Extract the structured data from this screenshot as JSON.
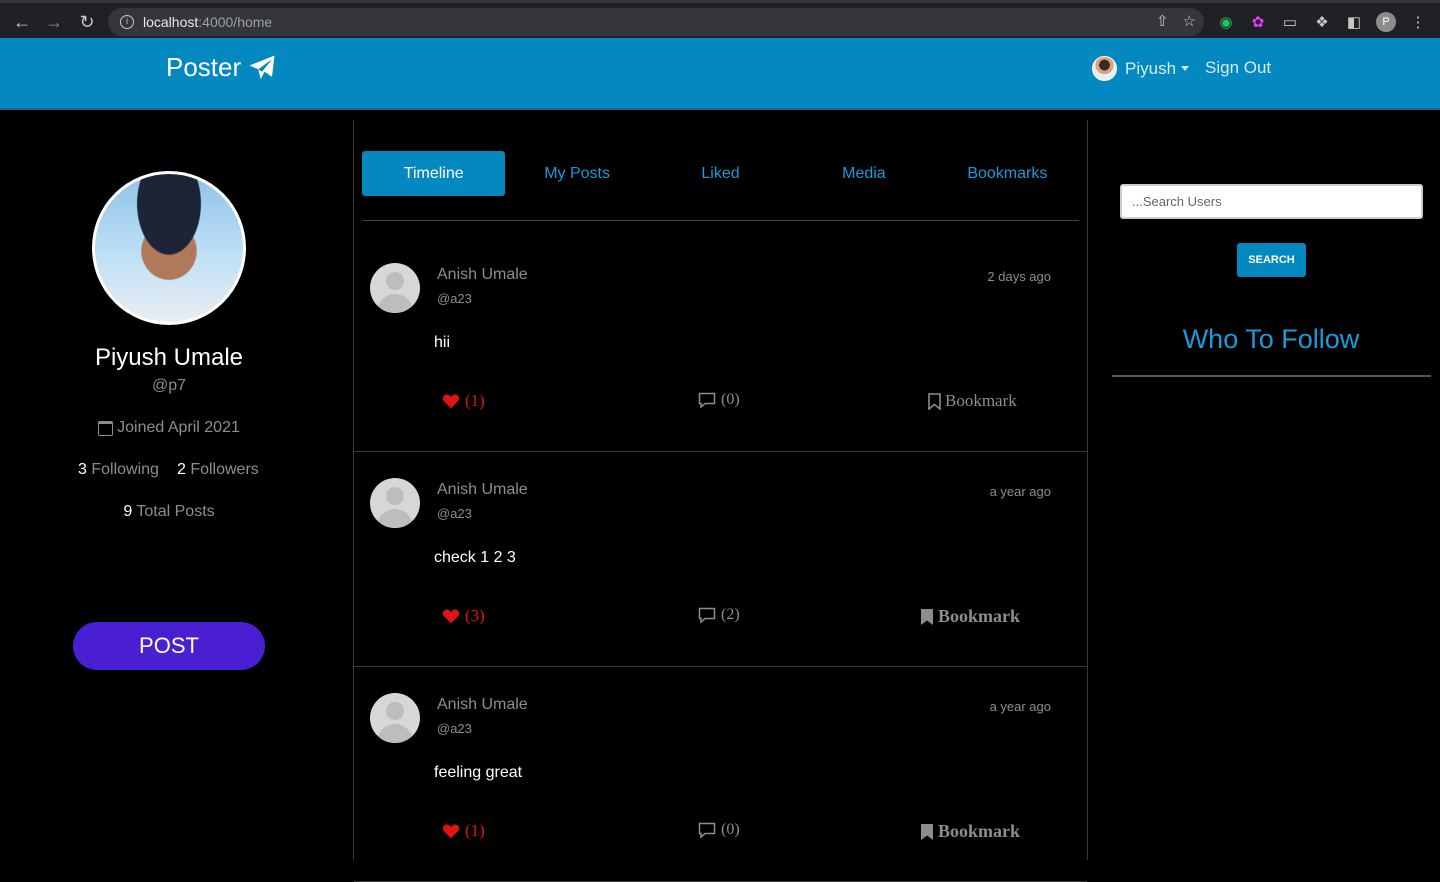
{
  "browser": {
    "url_host": "localhost",
    "url_path": ":4000/home",
    "profile_initial": "P"
  },
  "navbar": {
    "brand": "Poster",
    "user_name": "Piyush",
    "sign_out": "Sign Out"
  },
  "profile": {
    "name": "Piyush Umale",
    "handle": "@p7",
    "joined": "Joined April 2021",
    "following_count": "3",
    "following_label": "Following",
    "followers_count": "2",
    "followers_label": "Followers",
    "total_posts_count": "9",
    "total_posts_label": "Total Posts",
    "post_button": "POST"
  },
  "tabs": [
    {
      "label": "Timeline",
      "active": true
    },
    {
      "label": "My Posts",
      "active": false
    },
    {
      "label": "Liked",
      "active": false
    },
    {
      "label": "Media",
      "active": false
    },
    {
      "label": "Bookmarks",
      "active": false
    }
  ],
  "posts": [
    {
      "author": "Anish Umale",
      "handle": "@a23",
      "time": "2 days ago",
      "content": "hii",
      "likes": "(1)",
      "comments": "(0)",
      "bookmark": "Bookmark",
      "bookmarked": false
    },
    {
      "author": "Anish Umale",
      "handle": "@a23",
      "time": "a year ago",
      "content": "check 1 2 3",
      "likes": "(3)",
      "comments": "(2)",
      "bookmark": "Bookmark",
      "bookmarked": true
    },
    {
      "author": "Anish Umale",
      "handle": "@a23",
      "time": "a year ago",
      "content": "feeling great",
      "likes": "(1)",
      "comments": "(0)",
      "bookmark": "Bookmark",
      "bookmarked": true
    }
  ],
  "sidebar": {
    "search_placeholder": "...Search Users",
    "search_button": "SEARCH",
    "who_to_follow": "Who To Follow"
  },
  "colors": {
    "accent": "#0389c0",
    "post_button": "#4a1fd1",
    "like": "#e01414"
  }
}
